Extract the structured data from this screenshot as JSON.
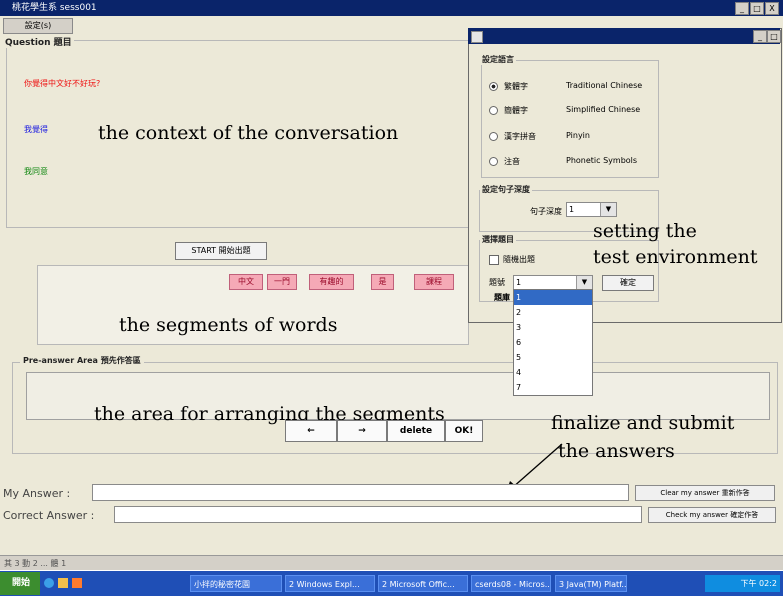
{
  "window": {
    "title": "桃花學生系 sess001",
    "menu_label": "設定(s)",
    "title_buttons": [
      "_",
      "□",
      "X"
    ]
  },
  "question": {
    "legend": "Question 題目",
    "line1": "你覺得中文好不好玩?",
    "line2": "我覺得",
    "line3": "我同意",
    "annotation": "the context of the conversation"
  },
  "start_button": "START 開始出題",
  "segments": {
    "items": [
      "中文",
      "一門",
      "有趣的",
      "是",
      "課程"
    ],
    "annotation": "the segments of words"
  },
  "preanswer": {
    "legend": "Pre-answer Area 預先作答區",
    "annotation": "the area for arranging the segments",
    "controls": [
      "←",
      "→",
      "delete",
      "OK!"
    ]
  },
  "submit_annotation": {
    "line1": "finalize and submit",
    "line2": "the answers"
  },
  "answers": {
    "my_label": "My Answer :",
    "correct_label": "Correct Answer :",
    "clear_button": "Clear my answer 重新作答",
    "check_button": "Check my answer 確定作答"
  },
  "statusbar": "其 3  動 2  ...  體 1",
  "dialog": {
    "language_legend": "設定語言",
    "languages": [
      {
        "zh": "繁體字",
        "en": "Traditional Chinese",
        "selected": true
      },
      {
        "zh": "簡體字",
        "en": "Simplified Chinese",
        "selected": false
      },
      {
        "zh": "漢字拼音",
        "en": "Pinyin",
        "selected": false
      },
      {
        "zh": "注音",
        "en": "Phonetic Symbols",
        "selected": false
      }
    ],
    "depth_legend": "設定句子深度",
    "depth_label": "句子深度",
    "depth_value": "1",
    "select_legend": "選擇題目",
    "random_label": "隨機出題",
    "number_label": "題號",
    "number_value": "1",
    "list_label": "題庫",
    "list_options": [
      "1",
      "2",
      "3",
      "6",
      "5",
      "4",
      "7"
    ],
    "confirm_button": "確定",
    "annotation_line1": "setting the",
    "annotation_line2": "test environment"
  },
  "taskbar": {
    "start": "開始",
    "items": [
      "小拌的秘密花園",
      "2 Windows Expl...",
      "2 Microsoft Offic...",
      "cserds08 - Micros...",
      "3 Java(TM) Platf..."
    ],
    "clock": "下午 02:2"
  }
}
